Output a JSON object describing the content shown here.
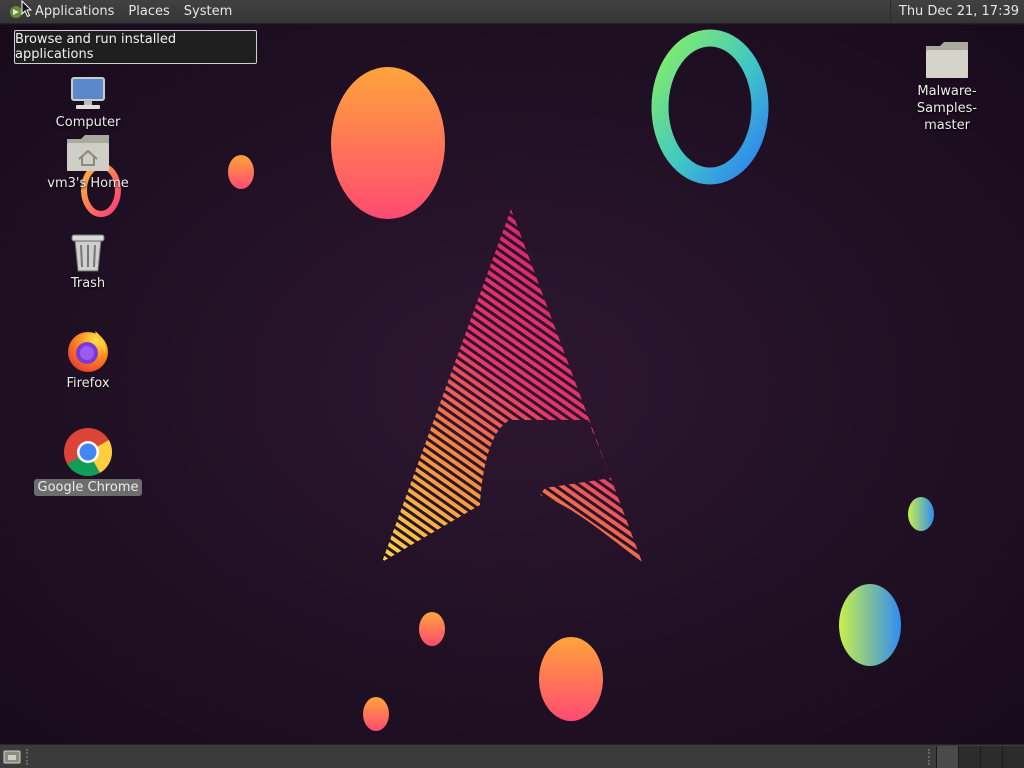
{
  "top_panel": {
    "menus": [
      "Applications",
      "Places",
      "System"
    ],
    "clock": "Thu Dec 21, 17:39"
  },
  "tooltip": {
    "text": "Browse and run installed applications"
  },
  "desktop_icons": {
    "computer": "Computer",
    "home": "vm3's Home",
    "trash": "Trash",
    "firefox": "Firefox",
    "chrome": "Google Chrome",
    "malware_folder_line1": "Malware-Samples-",
    "malware_folder_line2": "master"
  },
  "bottom_panel": {
    "workspaces_count": 4,
    "active_workspace": 1
  },
  "colors": {
    "panel": "#3b3b3b",
    "wallpaper": "#1e0f22",
    "arch_pink": "#e0306a",
    "arch_yellow": "#f6d646",
    "orb_orange": "#ffa23a",
    "orb_pink": "#ff4f6e"
  }
}
